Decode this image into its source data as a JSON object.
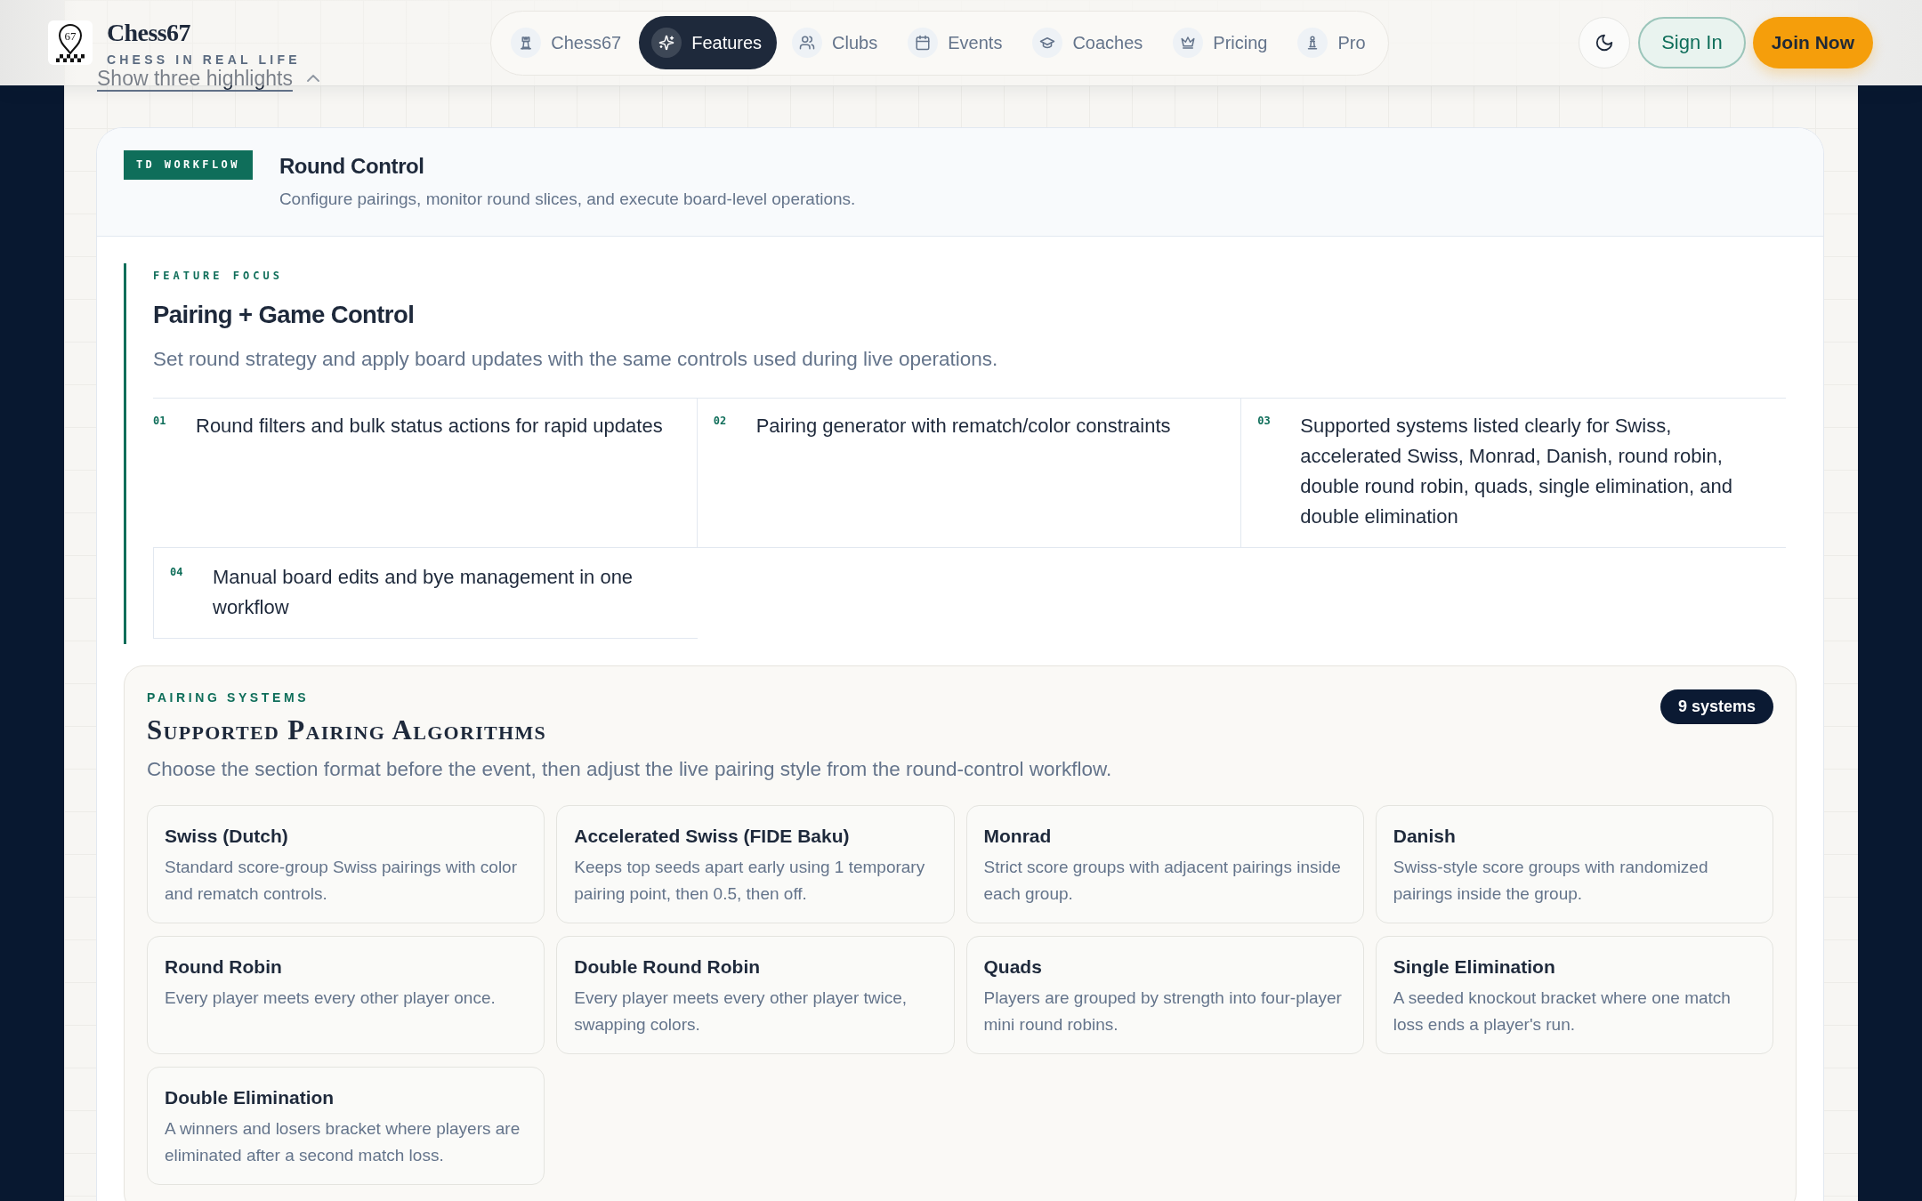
{
  "header": {
    "brand": {
      "logo_text": "67",
      "name": "Chess67",
      "tagline": "CHESS IN REAL LIFE"
    },
    "nav": [
      {
        "label": "Chess67",
        "selected": false
      },
      {
        "label": "Features",
        "selected": true
      },
      {
        "label": "Clubs",
        "selected": false
      },
      {
        "label": "Events",
        "selected": false
      },
      {
        "label": "Coaches",
        "selected": false
      },
      {
        "label": "Pricing",
        "selected": false
      },
      {
        "label": "Pro",
        "selected": false
      }
    ],
    "actions": [
      {
        "kind": "outline",
        "label": "Sign In"
      },
      {
        "kind": "primary",
        "label": "Join Now"
      }
    ]
  },
  "highlights_toggle": {
    "label": "Show three highlights"
  },
  "workflow": {
    "badge": "TD WORKFLOW",
    "title": "Round Control",
    "subtitle": "Configure pairings, monitor round slices, and execute board-level operations.",
    "focus": {
      "eyebrow": "FEATURE FOCUS",
      "title": "Pairing + Game Control",
      "description": "Set round strategy and apply board updates with the same controls used during live operations.",
      "steps": [
        {
          "number": "01",
          "text": "Round filters and bulk status actions for rapid updates"
        },
        {
          "number": "02",
          "text": "Pairing generator with rematch/color constraints"
        },
        {
          "number": "03",
          "text": "Supported systems listed clearly for Swiss, accelerated Swiss, Monrad, Danish, round robin, double round robin, quads, single elimination, and double elimination"
        },
        {
          "number": "04",
          "text": "Manual board edits and bye management in one workflow"
        }
      ]
    },
    "pairing_systems": {
      "eyebrow": "PAIRING SYSTEMS",
      "title": "Supported Pairing Algorithms",
      "count": "9 systems",
      "description": "Choose the section format before the event, then adjust the live pairing style from the round-control workflow.",
      "systems": [
        {
          "name": "Swiss (Dutch)",
          "description": "Standard score-group Swiss pairings with color and rematch controls."
        },
        {
          "name": "Accelerated Swiss (FIDE Baku)",
          "description": "Keeps top seeds apart early using 1 temporary pairing point, then 0.5, then off."
        },
        {
          "name": "Monrad",
          "description": "Strict score groups with adjacent pairings inside each group."
        },
        {
          "name": "Danish",
          "description": "Swiss-style score groups with randomized pairings inside the group."
        },
        {
          "name": "Round Robin",
          "description": "Every player meets every other player once."
        },
        {
          "name": "Double Round Robin",
          "description": "Every player meets every other player twice, swapping colors."
        },
        {
          "name": "Quads",
          "description": "Players are grouped by strength into four-player mini round robins."
        },
        {
          "name": "Single Elimination",
          "description": "A seeded knockout bracket where one match loss ends a player's run."
        },
        {
          "name": "Double Elimination",
          "description": "A winners and losers bracket where players are eliminated after a second match loss."
        }
      ]
    }
  }
}
